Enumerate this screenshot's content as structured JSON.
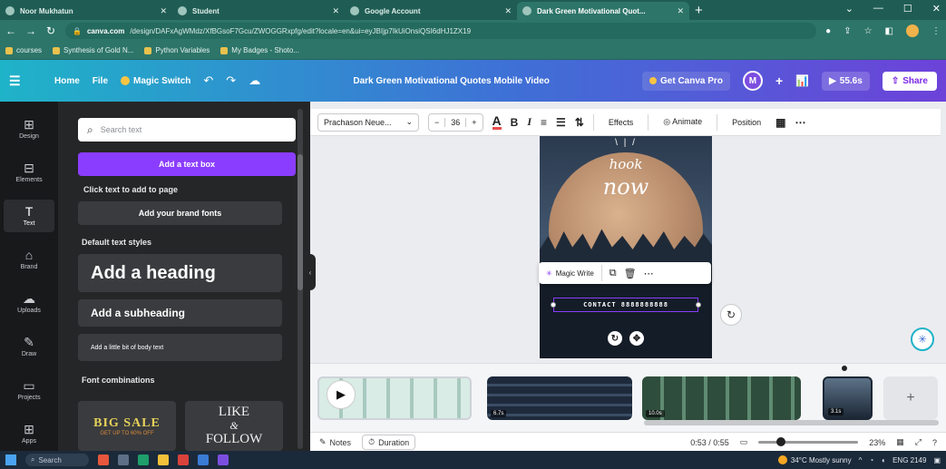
{
  "browser": {
    "tabs": [
      {
        "title": "Noor Mukhatun",
        "active": false
      },
      {
        "title": "Student",
        "active": false
      },
      {
        "title": "Google Account",
        "active": false
      },
      {
        "title": "Dark Green Motivational Quot...",
        "active": true
      }
    ],
    "url_domain": "canva.com",
    "url_rest": "/design/DAFxAgWMdz/XfBGsoF7Gcu/ZWOGGRxpfg/edit?locale=en&ui=eyJBIjp7IkUiOnsiQSI6dHJ1ZX19",
    "bookmarks": [
      "courses",
      "Synthesis of Gold N...",
      "Python Variables",
      "My Badges - Shoto..."
    ]
  },
  "canva_bar": {
    "home": "Home",
    "file": "File",
    "magic_switch": "Magic Switch",
    "doc_title": "Dark Green Motivational Quotes Mobile Video",
    "get_pro": "Get Canva Pro",
    "avatar_initial": "M",
    "play_time": "55.6s",
    "share": "Share"
  },
  "rail": [
    {
      "label": "Design",
      "icon": "design-icon"
    },
    {
      "label": "Elements",
      "icon": "elements-icon"
    },
    {
      "label": "Text",
      "icon": "text-icon",
      "active": true
    },
    {
      "label": "Brand",
      "icon": "brand-icon"
    },
    {
      "label": "Uploads",
      "icon": "uploads-icon"
    },
    {
      "label": "Draw",
      "icon": "draw-icon"
    },
    {
      "label": "Projects",
      "icon": "projects-icon"
    },
    {
      "label": "Apps",
      "icon": "apps-icon"
    }
  ],
  "panel": {
    "search_placeholder": "Search text",
    "add_textbox": "Add a text box",
    "hint": "Click text to add to page",
    "brand_fonts": "Add your brand fonts",
    "default_styles": "Default text styles",
    "heading": "Add a heading",
    "subheading": "Add a subheading",
    "body": "Add a little bit of body text",
    "font_combos": "Font combinations",
    "combo1_big": "BIG SALE",
    "combo1_small": "GET UP TO 60% OFF",
    "combo2_line1": "LIKE",
    "combo2_amp": "&",
    "combo2_line2": "FOLLOW"
  },
  "toolbar": {
    "font": "Prachason Neue...",
    "size": "36",
    "effects": "Effects",
    "animate": "Animate",
    "position": "Position"
  },
  "design": {
    "hook": "hook",
    "now": "now",
    "contact": "CONTACT 8888888888",
    "magic_write": "Magic Write"
  },
  "timeline": {
    "clip1_dur": "",
    "clip2_dur": "6.7s",
    "clip3_dur": "10.0s",
    "clip4_dur": "3.1s"
  },
  "footer": {
    "notes": "Notes",
    "duration": "Duration",
    "time": "0:53 / 0:55",
    "zoom": "23%"
  },
  "taskbar": {
    "search": "Search",
    "weather": "34°C Mostly sunny",
    "clock": "ENG 2149"
  }
}
